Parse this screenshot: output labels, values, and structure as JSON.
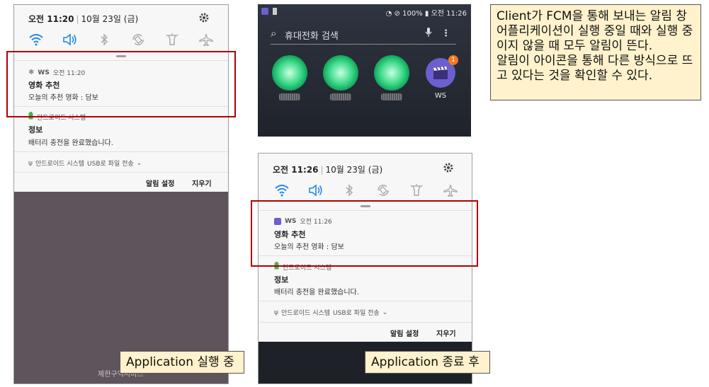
{
  "left_phone": {
    "status": {
      "time": "오전 11:20",
      "date": "10월 23일 (금)"
    },
    "notifications": [
      {
        "app": "WS",
        "time": "오전 11:20",
        "title": "영화 추천",
        "text": "오늘의 추천 영화 : 담보"
      },
      {
        "app": "안드로이드 시스템",
        "title": "정보",
        "text": "배터리 충전을 완료했습니다."
      }
    ],
    "usb": {
      "app": "안드로이드 시스템",
      "text": "USB로 파일 전송"
    },
    "actions": {
      "settings": "알림 설정",
      "clear": "지우기"
    },
    "footer": "제한구역서비스"
  },
  "home_screen": {
    "status": {
      "battery": "100%",
      "time": "오전 11:26"
    },
    "search_placeholder": "휴대전화 검색",
    "apps": [
      {
        "label": ""
      },
      {
        "label": ""
      },
      {
        "label": ""
      },
      {
        "label": "WS",
        "badge": "1"
      }
    ]
  },
  "right_phone": {
    "status": {
      "time": "오전 11:26",
      "date": "10월 23일 (금)"
    },
    "notifications": [
      {
        "app": "WS",
        "time": "오전 11:26",
        "title": "영화 추천",
        "text": "오늘의 추천 영화 : 담보"
      },
      {
        "app": "안드로이드 시스템",
        "title": "정보",
        "text": "배터리 충전을 완료했습니다."
      }
    ],
    "usb": {
      "app": "안드로이드 시스템",
      "text": "USB로 파일 전송"
    },
    "actions": {
      "settings": "알림 설정",
      "clear": "지우기"
    }
  },
  "captions": {
    "running": "Application 실행 중",
    "closed": "Application 종료 후"
  },
  "note": {
    "line1": "Client가 FCM을 통해 보내는 알림 창",
    "line2": "어플리케이션이 실행 중일 때와 실행 중이지 않을 때 모두 알림이 뜬다.",
    "line3": "알림이 아이콘을 통해 다른 방식으로 뜨고 있다는 것을 확인할 수 있다."
  },
  "colors": {
    "accent": "#1e88e5",
    "highlight_box": "#b00000",
    "caption_bg": "#fff2cc",
    "badge": "#f07a1e"
  }
}
